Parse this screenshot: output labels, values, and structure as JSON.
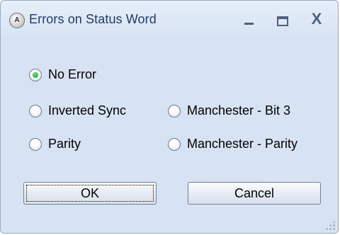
{
  "window": {
    "icon_label": "A",
    "title": "Errors on Status Word"
  },
  "titlebar_buttons": {
    "minimize": "_",
    "maximize": "□",
    "close": "X"
  },
  "options": [
    {
      "label": "No Error",
      "checked": true
    },
    {
      "label": "Inverted Sync",
      "checked": false
    },
    {
      "label": "Manchester - Bit 3",
      "checked": false
    },
    {
      "label": "Parity",
      "checked": false
    },
    {
      "label": "Manchester - Parity",
      "checked": false
    }
  ],
  "buttons": {
    "ok": "OK",
    "cancel": "Cancel"
  },
  "colors": {
    "window_bg": "#d7e3f3",
    "title_text": "#1f3b6b",
    "radio_selected": "#1e9b2f"
  }
}
